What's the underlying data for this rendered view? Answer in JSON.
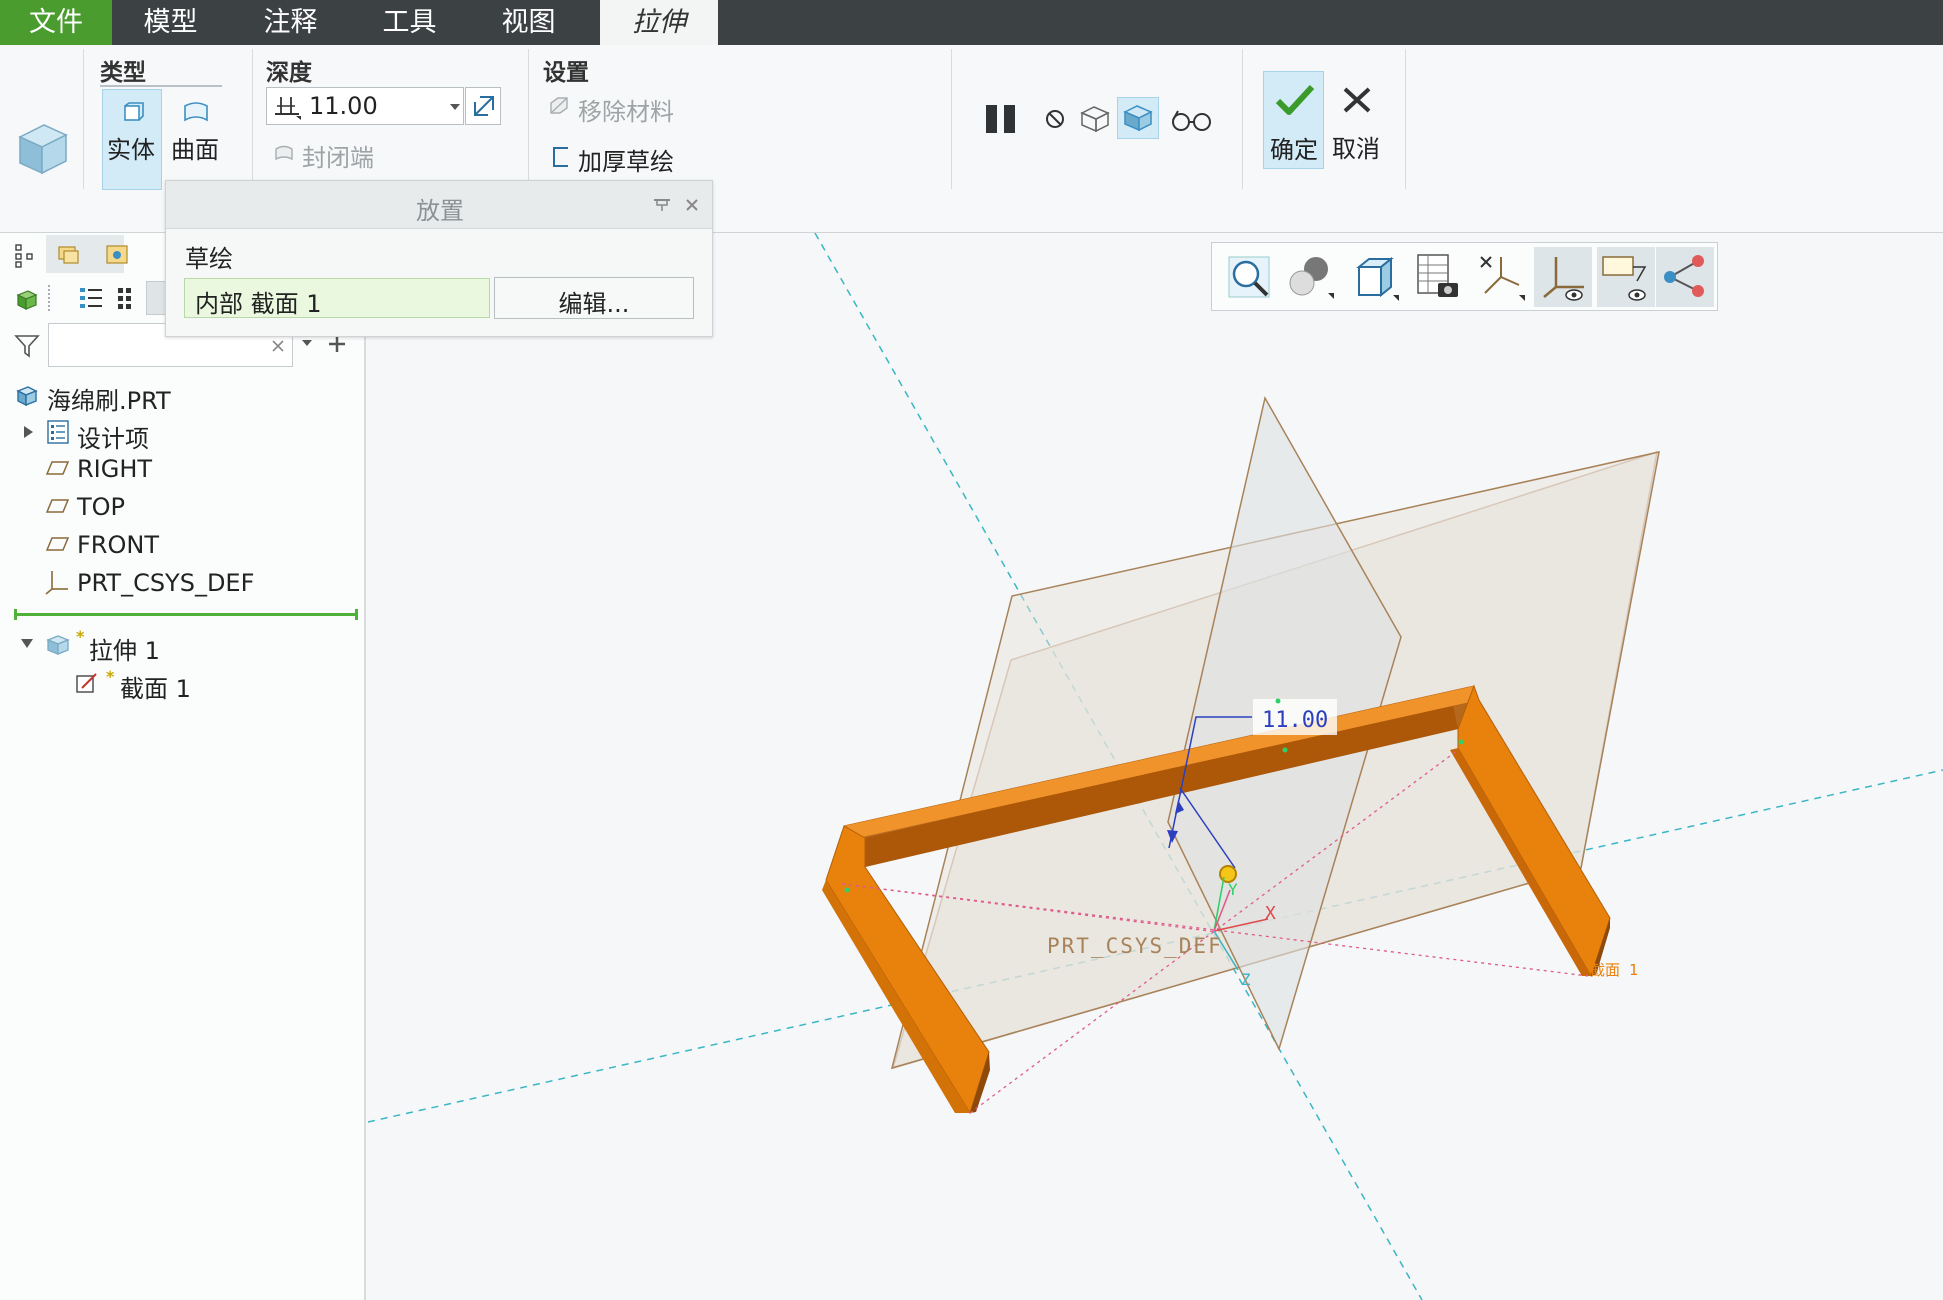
{
  "menu": {
    "file": "文件",
    "model": "模型",
    "annotate": "注释",
    "tools": "工具",
    "view": "视图",
    "extrude": "拉伸"
  },
  "ribbon": {
    "type_group": {
      "title": "类型",
      "solid": "实体",
      "surface": "曲面"
    },
    "depth_group": {
      "title": "深度",
      "value": "11.00",
      "capped_ends": "封闭端"
    },
    "settings_group": {
      "title": "设置",
      "remove_material": "移除材料",
      "thicken_sketch": "加厚草绘"
    },
    "ok": "确定",
    "cancel": "取消"
  },
  "placement_panel": {
    "title": "放置",
    "sketch_label": "草绘",
    "sketch_value": "内部 截面 1",
    "edit_button": "编辑..."
  },
  "model_tree": {
    "root": "海绵刷.PRT",
    "items": [
      "设计项",
      "RIGHT",
      "TOP",
      "FRONT",
      "PRT_CSYS_DEF"
    ],
    "feature": "拉伸 1",
    "feature_child": "截面 1",
    "new_marker": "*"
  },
  "viewport": {
    "dimension": "11.00",
    "csys_label": "PRT_CSYS_DEF",
    "axis_x": "X",
    "axis_y": "Y",
    "axis_z": "Z",
    "section_tag": "截面 1"
  },
  "colors": {
    "file_menu": "#4a9c2f",
    "accent_green": "#4a9c2f",
    "extrude_orange": "#e8820c",
    "extrude_dark": "#8f4a0b",
    "selected_blue": "#d2ebf7"
  }
}
